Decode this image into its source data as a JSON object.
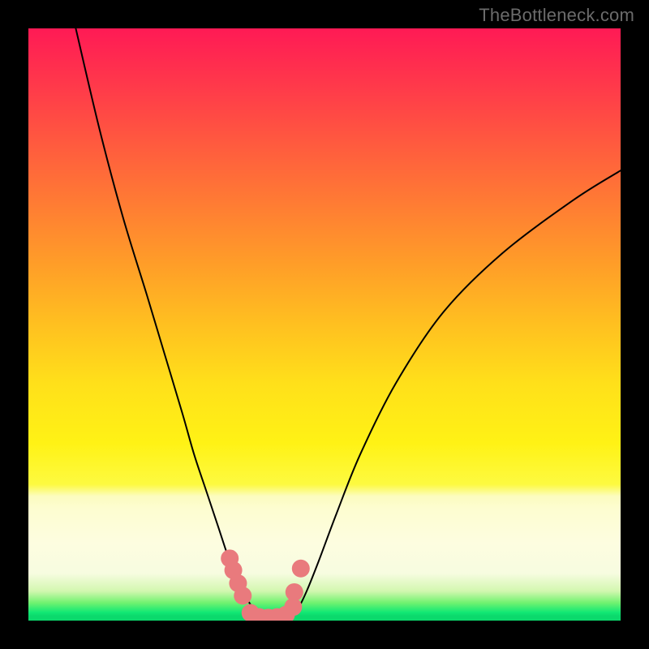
{
  "watermark": "TheBottleneck.com",
  "chart_data": {
    "type": "line",
    "title": "",
    "xlabel": "",
    "ylabel": "",
    "xlim": [
      0,
      100
    ],
    "ylim": [
      0,
      100
    ],
    "grid": false,
    "legend": false,
    "series": [
      {
        "name": "left-curve",
        "x": [
          8,
          12,
          16,
          20,
          23,
          26,
          28,
          30,
          32,
          34,
          35.5,
          37,
          38.5,
          40
        ],
        "values": [
          100,
          83,
          68,
          55,
          45,
          35,
          28,
          22,
          16,
          10,
          6.5,
          3.5,
          1.5,
          0.5
        ]
      },
      {
        "name": "right-curve",
        "x": [
          44,
          45.5,
          47,
          49,
          52,
          56,
          62,
          70,
          80,
          92,
          100
        ],
        "values": [
          0.5,
          2,
          5,
          10,
          18,
          28,
          40,
          52,
          62,
          71,
          76
        ]
      },
      {
        "name": "dots-left-arm",
        "x": [
          34.0,
          34.6,
          35.4,
          36.2
        ],
        "values": [
          10.5,
          8.5,
          6.3,
          4.2
        ]
      },
      {
        "name": "dots-bottom",
        "x": [
          37.5,
          39.0,
          40.5,
          42.0,
          43.5
        ],
        "values": [
          1.3,
          0.6,
          0.5,
          0.6,
          1.0
        ]
      },
      {
        "name": "dots-right-arm",
        "x": [
          44.7,
          44.9
        ],
        "values": [
          2.3,
          4.8
        ]
      },
      {
        "name": "dot-upper-right",
        "x": [
          46.0
        ],
        "values": [
          8.8
        ]
      }
    ],
    "colors": {
      "curve": "#000000",
      "dots": "#e97a7d",
      "gradient_top": "#ff1a55",
      "gradient_mid": "#fff215",
      "gradient_bottom": "#0bd96c"
    }
  }
}
